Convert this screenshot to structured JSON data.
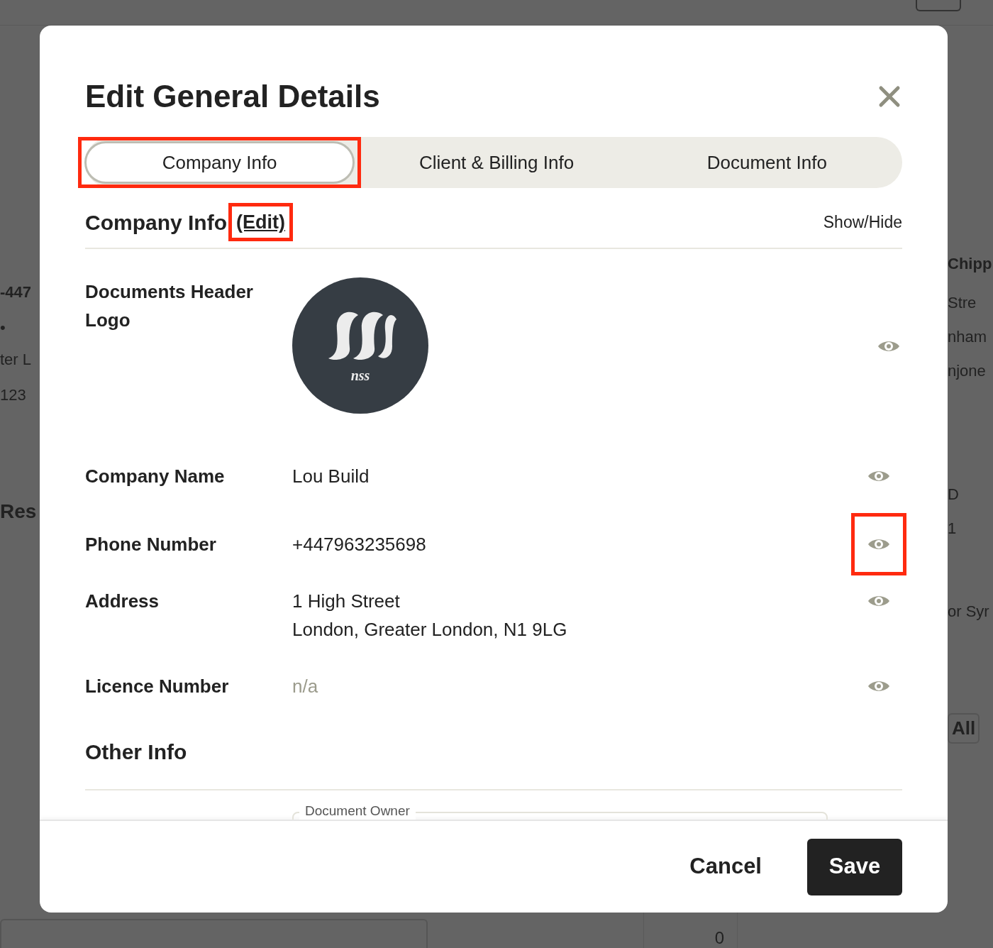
{
  "background": {
    "left": [
      {
        "text": "-447",
        "kind": "bold"
      },
      {
        "text": "•",
        "kind": "plain"
      },
      {
        "text": "ter L",
        "kind": "plain"
      },
      {
        "text": "123",
        "kind": "plain"
      },
      {
        "text": "Res",
        "kind": "heading"
      }
    ],
    "right": [
      {
        "text": "Chipp",
        "kind": "bold"
      },
      {
        "text": "Stre",
        "kind": "plain"
      },
      {
        "text": "nham",
        "kind": "plain"
      },
      {
        "text": "njone",
        "kind": "plain"
      },
      {
        "text": "D",
        "kind": "small"
      },
      {
        "text": "1",
        "kind": "plain"
      },
      {
        "text": "or Syr",
        "kind": "small"
      },
      {
        "text": "All",
        "kind": "button"
      }
    ],
    "bottom_cell": "0"
  },
  "dialog": {
    "title": "Edit General Details",
    "tabs": [
      {
        "label": "Company Info",
        "selected": true,
        "highlighted": true
      },
      {
        "label": "Client & Billing Info",
        "selected": false,
        "highlighted": false
      },
      {
        "label": "Document Info",
        "selected": false,
        "highlighted": false
      }
    ],
    "section": {
      "title": "Company Info",
      "edit_link": "(Edit)",
      "edit_highlighted": true,
      "toggle_label": "Show/Hide"
    },
    "logo_row": {
      "label": "Documents Header Logo",
      "logo_text": "nss",
      "visible": true
    },
    "fields": [
      {
        "label": "Company Name",
        "value": [
          "Lou Build"
        ],
        "empty": false,
        "visible": true,
        "highlighted": false
      },
      {
        "label": "Phone Number",
        "value": [
          "+447963235698"
        ],
        "empty": false,
        "visible": true,
        "highlighted": true
      },
      {
        "label": "Address",
        "value": [
          "1 High Street",
          "London, Greater London, N1 9LG"
        ],
        "empty": false,
        "visible": true,
        "highlighted": false
      },
      {
        "label": "Licence Number",
        "value": [
          "n/a"
        ],
        "empty": true,
        "visible": true,
        "highlighted": false
      }
    ],
    "other_section": {
      "title": "Other Info",
      "field_label": "Document Owner"
    },
    "buttons": {
      "cancel": "Cancel",
      "save": "Save"
    }
  }
}
